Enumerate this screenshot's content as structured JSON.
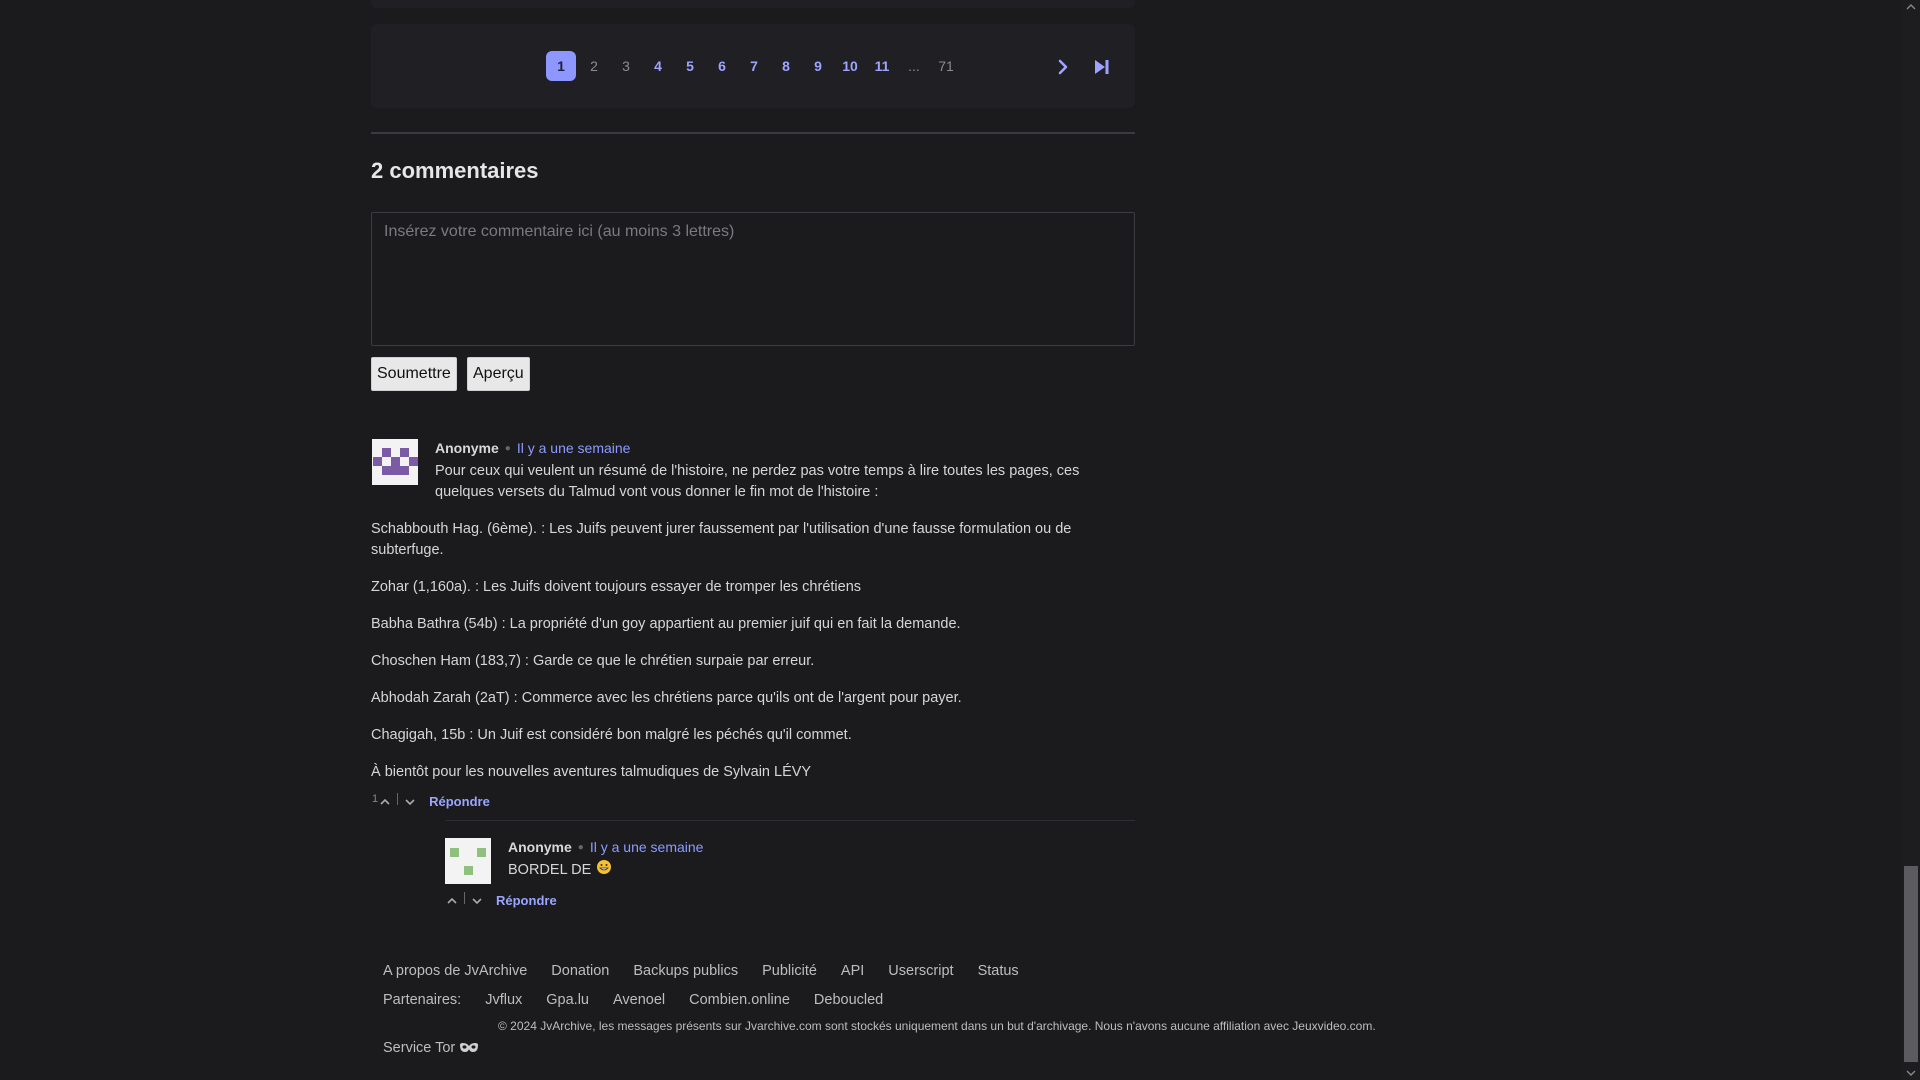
{
  "pagination": {
    "pages": [
      {
        "label": "1",
        "state": "active"
      },
      {
        "label": "2",
        "state": "dim"
      },
      {
        "label": "3",
        "state": "dim"
      },
      {
        "label": "4",
        "state": "link"
      },
      {
        "label": "5",
        "state": "link"
      },
      {
        "label": "6",
        "state": "link"
      },
      {
        "label": "7",
        "state": "link"
      },
      {
        "label": "8",
        "state": "link"
      },
      {
        "label": "9",
        "state": "link"
      },
      {
        "label": "10",
        "state": "link"
      },
      {
        "label": "11",
        "state": "link"
      },
      {
        "label": "...",
        "state": "dim"
      },
      {
        "label": "71",
        "state": "dim"
      }
    ],
    "next_icon": "chevron-right-icon",
    "last_icon": "skip-to-end-icon"
  },
  "comments_section": {
    "title": "2 commentaires",
    "placeholder": "Insérez votre commentaire ici (au moins 3 lettres)",
    "submit_label": "Soumettre",
    "preview_label": "Aperçu"
  },
  "comments": [
    {
      "author": "Anonyme",
      "time": "Il y a une semaine",
      "intro": "Pour ceux qui veulent un résumé de l'histoire, ne perdez pas votre temps à lire toutes les pages, ces quelques versets du Talmud vont vous donner le fin mot de l'histoire :",
      "paragraphs": [
        "Schabbouth Hag. (6ème). : Les Juifs peuvent jurer faussement par l'utilisation d'une fausse formulation ou de subterfuge.",
        "Zohar (1,160a). : Les Juifs doivent toujours essayer de tromper les chrétiens",
        "Babha Bathra (54b) : La propriété d'un goy appartient au premier juif qui en fait la demande.",
        "Choschen Ham (183,7) : Garde ce que le chrétien surpaie par erreur.",
        "Abhodah Zarah (2aT) : Commerce avec les chrétiens parce qu'ils ont de l'argent pour payer.",
        "Chagigah, 15b : Un Juif est considéré bon malgré les péchés qu'il commet.",
        "À bientôt pour les nouvelles aventures talmudiques de Sylvain LÉVY"
      ],
      "score": "1",
      "reply_label": "Répondre",
      "avatar_color": "#7b5aa6"
    },
    {
      "author": "Anonyme",
      "time": "Il y a une semaine",
      "text": "BORDEL DE",
      "emoji": "grinning-face-icon",
      "score": "",
      "reply_label": "Répondre",
      "avatar_color": "#8fc07e"
    }
  ],
  "footer": {
    "links": [
      "A propos de JvArchive",
      "Donation",
      "Backups publics",
      "Publicité",
      "API",
      "Userscript",
      "Status"
    ],
    "partners_label": "Partenaires:",
    "partners": [
      "Jvflux",
      "Gpa.lu",
      "Avenoel",
      "Combien.online",
      "Deboucled"
    ],
    "copyright": "© 2024 JvArchive, les messages présents sur Jvarchive.com sont stockés uniquement dans un but d'archivage. Nous n'avons aucune affiliation avec Jeuxvideo.com.",
    "tor_label": "Service Tor",
    "tor_icon": "mask-icon"
  },
  "colors": {
    "background": "#1b1b1e",
    "card": "#202024",
    "accent": "#8d97ff",
    "link": "#9aa5ff"
  }
}
